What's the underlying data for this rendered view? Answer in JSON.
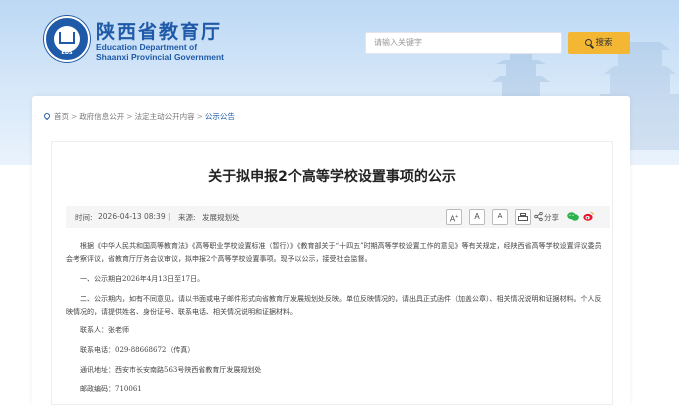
{
  "header": {
    "logo_emblem_text": "EDS",
    "site_title": "陕西省教育厅",
    "site_sub_en1": "Education Department of",
    "site_sub_en2": "Shaanxi Provincial Government",
    "search_placeholder": "请输入关键字",
    "search_button": "搜索"
  },
  "breadcrumb": {
    "items": [
      "首页",
      "政府信息公开",
      "法定主动公开内容",
      "公示公告"
    ],
    "separator": ">"
  },
  "article": {
    "title": "关于拟申报2个高等学校设置事项的公示",
    "meta": {
      "time_label": "时间:",
      "time": "2026-04-13 08:39",
      "divider": "|",
      "source_label": "来源:",
      "source": "发展规划处"
    },
    "toolbar": {
      "font_large": "A",
      "font_large_sup": "+",
      "font_medium": "A",
      "font_small": "A",
      "share_label": "分享"
    },
    "paragraphs": [
      "根据《中华人民共和国高等教育法》《高等职业学校设置标准（暂行）》《教育部关于“十四五”时期高等学校设置工作的意见》等有关规定，经陕西省高等学校设置评议委员会考察评议，省教育厅厅务会议审议，拟申报2个高等学校设置事项。现予以公示，接受社会监督。",
      "一、公示期自2026年4月13日至17日。",
      "二、公示期内，如有不同意见，请以书面或电子邮件形式向省教育厅发展规划处反映。单位反映情况的，请出具正式函件（加盖公章）、相关情况说明和证据材料。个人反映情况的，请提供姓名、身份证号、联系电话、相关情况说明和证据材料。",
      "联系人：张老师",
      "联系电话：029-88668672（传真）",
      "通讯地址：西安市长安南路563号陕西省教育厅发展规划处",
      "邮政编码：710061"
    ]
  },
  "colors": {
    "brand_blue": "#1f5aa8",
    "search_button_bg": "#f3b733",
    "hero_bg": "#cfe3f7"
  }
}
